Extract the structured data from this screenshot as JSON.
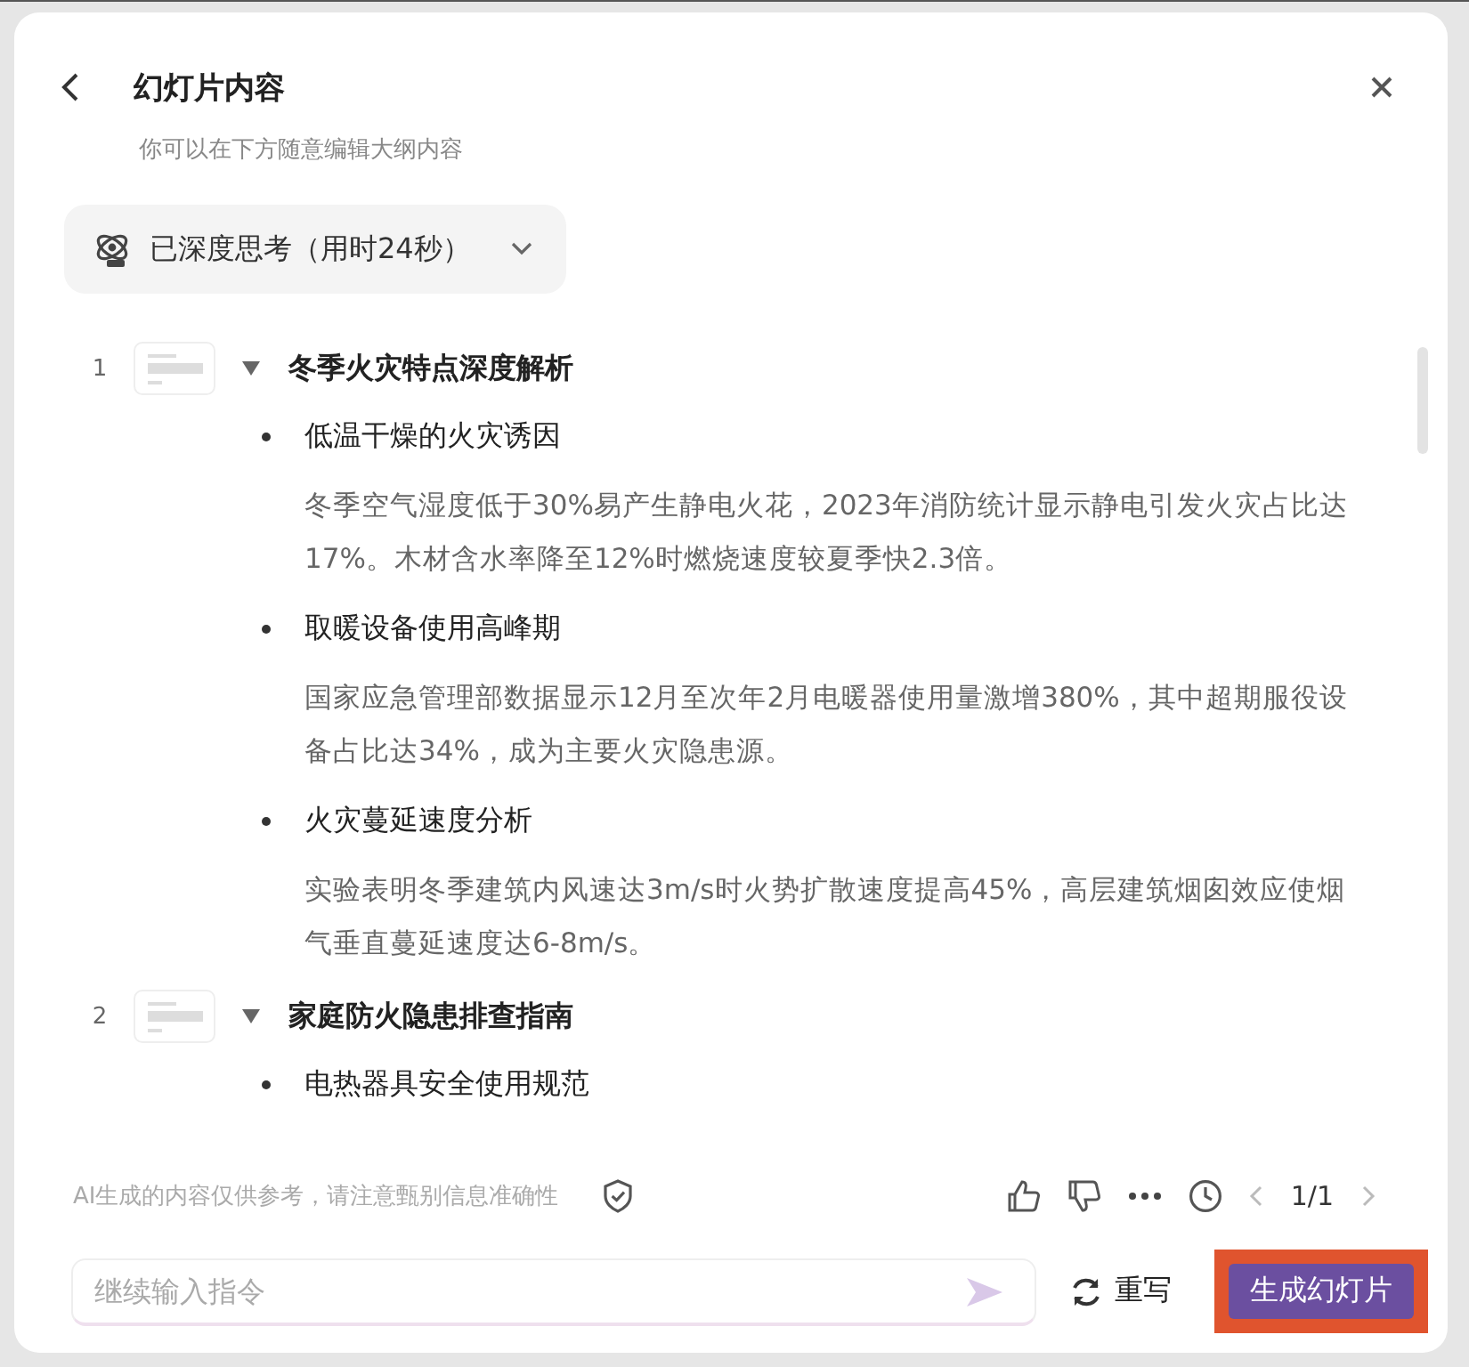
{
  "header": {
    "title": "幻灯片内容",
    "subtitle": "你可以在下方随意编辑大纲内容"
  },
  "thinking": {
    "label": "已深度思考（用时24秒）",
    "expanded": false
  },
  "sections": [
    {
      "number": "1",
      "title": "冬季火灾特点深度解析",
      "expanded": true,
      "items": [
        {
          "heading": "低温干燥的火灾诱因",
          "body": "冬季空气湿度低于30%易产生静电火花，2023年消防统计显示静电引发火灾占比达17%。木材含水率降至12%时燃烧速度较夏季快2.3倍。"
        },
        {
          "heading": "取暖设备使用高峰期",
          "body": "国家应急管理部数据显示12月至次年2月电暖器使用量激增380%，其中超期服役设备占比达34%，成为主要火灾隐患源。"
        },
        {
          "heading": "火灾蔓延速度分析",
          "body": "实验表明冬季建筑内风速达3m/s时火势扩散速度提高45%，高层建筑烟囱效应使烟气垂直蔓延速度达6-8m/s。"
        }
      ]
    },
    {
      "number": "2",
      "title": "家庭防火隐患排查指南",
      "expanded": true,
      "items": [
        {
          "heading": "电热器具安全使用规范"
        }
      ]
    }
  ],
  "footer": {
    "disclaimer": "AI生成的内容仅供参考，请注意甄别信息准确性",
    "pager": "1/1"
  },
  "input": {
    "placeholder": "继续输入指令"
  },
  "actions": {
    "rewrite": "重写",
    "generate": "生成幻灯片"
  }
}
